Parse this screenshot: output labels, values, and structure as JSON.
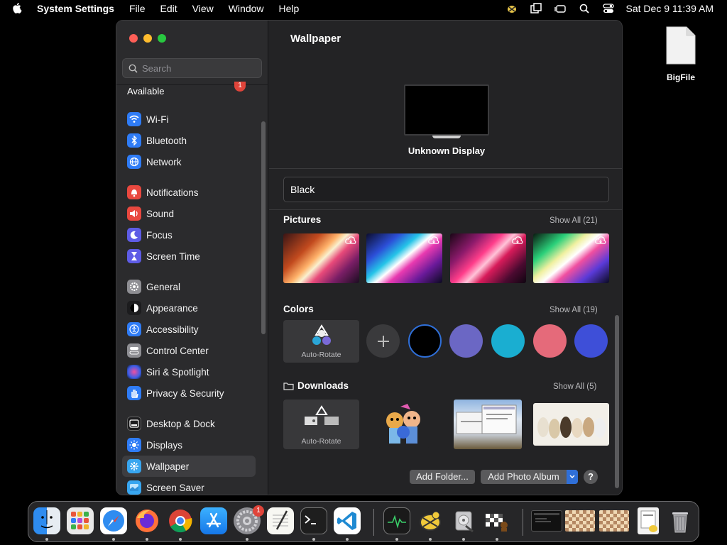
{
  "menubar": {
    "app_name": "System Settings",
    "menus": [
      "File",
      "Edit",
      "View",
      "Window",
      "Help"
    ],
    "clock": "Sat Dec 9  11:39 AM"
  },
  "desktop": {
    "file_label": "BigFile"
  },
  "sidebar": {
    "search_placeholder": "Search",
    "update_label": "Available",
    "update_badge": "1",
    "items": [
      {
        "label": "Wi-Fi",
        "icon": "wifi-icon",
        "color": "#2f7cf6"
      },
      {
        "label": "Bluetooth",
        "icon": "bluetooth-icon",
        "color": "#2f7cf6"
      },
      {
        "label": "Network",
        "icon": "globe-icon",
        "color": "#2f7cf6"
      },
      {
        "label": "Notifications",
        "icon": "bell-icon",
        "color": "#e9483f"
      },
      {
        "label": "Sound",
        "icon": "speaker-icon",
        "color": "#e9483f"
      },
      {
        "label": "Focus",
        "icon": "moon-icon",
        "color": "#5e5ce6"
      },
      {
        "label": "Screen Time",
        "icon": "hourglass-icon",
        "color": "#5e5ce6"
      },
      {
        "label": "General",
        "icon": "gear-icon",
        "color": "#8e8e93"
      },
      {
        "label": "Appearance",
        "icon": "appearance-icon",
        "color": "#1c1c1e"
      },
      {
        "label": "Accessibility",
        "icon": "accessibility-icon",
        "color": "#2f7cf6"
      },
      {
        "label": "Control Center",
        "icon": "control-center-icon",
        "color": "#8e8e93"
      },
      {
        "label": "Siri & Spotlight",
        "icon": "siri-icon",
        "color": "#b44ad8"
      },
      {
        "label": "Privacy & Security",
        "icon": "hand-icon",
        "color": "#2f7cf6"
      },
      {
        "label": "Desktop & Dock",
        "icon": "dock-icon",
        "color": "#1c1c1e"
      },
      {
        "label": "Displays",
        "icon": "sun-icon",
        "color": "#2f7cf6"
      },
      {
        "label": "Wallpaper",
        "icon": "wallpaper-icon",
        "color": "#38a6f0"
      },
      {
        "label": "Screen Saver",
        "icon": "screensaver-icon",
        "color": "#38a6f0"
      }
    ],
    "selected": "Wallpaper"
  },
  "main": {
    "title": "Wallpaper",
    "display_label": "Unknown Display",
    "current_wallpaper": "Black",
    "pictures": {
      "title": "Pictures",
      "show_all": "Show All (21)"
    },
    "colors": {
      "title": "Colors",
      "show_all": "Show All (19)",
      "auto_rotate": "Auto-Rotate",
      "swatches": [
        "#000000",
        "#6b67c4",
        "#1aaed1",
        "#e56a7a",
        "#3e4fd8"
      ]
    },
    "downloads": {
      "title": "Downloads",
      "show_all": "Show All (5)",
      "auto_rotate": "Auto-Rotate"
    },
    "buttons": {
      "add_folder": "Add Folder...",
      "add_album": "Add Photo Album",
      "help": "?"
    }
  },
  "dock": {
    "settings_badge": "1",
    "apps": [
      "finder-icon",
      "launchpad-icon",
      "safari-icon",
      "firefox-icon",
      "chrome-icon",
      "app-store-icon",
      "system-settings-icon",
      "textedit-icon",
      "terminal-icon",
      "vscode-icon",
      "activity-monitor-icon",
      "cyberduck-icon",
      "disk-utility-icon",
      "chess-icon"
    ]
  }
}
